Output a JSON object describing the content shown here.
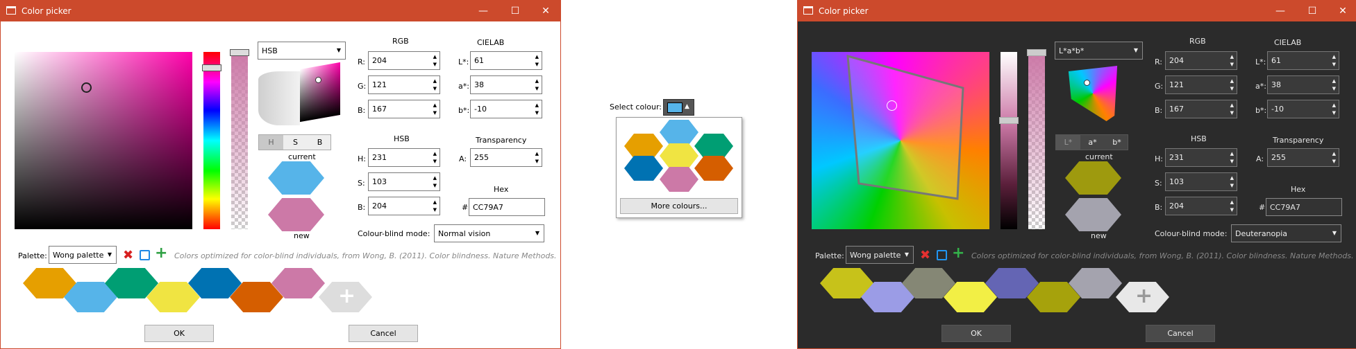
{
  "window_title": "Color picker",
  "title_buttons": {
    "minimize": "—",
    "maximize": "☐",
    "close": "✕"
  },
  "labels": {
    "rgb": "RGB",
    "cielab": "CIELAB",
    "hsb": "HSB",
    "transparency": "Transparency",
    "hex": "Hex",
    "r": "R:",
    "g": "G:",
    "b": "B:",
    "l": "L*:",
    "a_star": "a*:",
    "b_star": "b*:",
    "h": "H:",
    "s": "S:",
    "bri": "B:",
    "alpha": "A:",
    "hash": "#",
    "current": "current",
    "new": "new",
    "colour_blind_mode": "Colour-blind mode:",
    "palette": "Palette:"
  },
  "values": {
    "r": "204",
    "g": "121",
    "b": "167",
    "l": "61",
    "a_star": "38",
    "b_star": "-10",
    "h": "231",
    "s": "103",
    "bri": "204",
    "alpha": "255",
    "hex": "CC79A7"
  },
  "light": {
    "mode": "HSB",
    "tabs": [
      "H",
      "S",
      "B"
    ],
    "colour_blind": "Normal vision"
  },
  "dark": {
    "mode": "L*a*b*",
    "tabs": [
      "L*",
      "a*",
      "b*"
    ],
    "colour_blind": "Deuteranopia"
  },
  "palette": {
    "name": "Wong palette",
    "description": "Colors optimized for color-blind individuals, from Wong, B. (2011). Color blindness. Nature Methods.",
    "add_glyph": "+",
    "colors": [
      "#E69F00",
      "#56B4E9",
      "#009E73",
      "#F0E442",
      "#0072B2",
      "#D55E00",
      "#CC79A7"
    ],
    "dark_colors": [
      "#c7c21a",
      "#9b9ce6",
      "#858775",
      "#f2ef45",
      "#6465b4",
      "#a6a20c",
      "#a4a3ae"
    ]
  },
  "buttons": {
    "ok": "OK",
    "cancel": "Cancel"
  },
  "popup": {
    "label": "Select colour:",
    "more": "More colours...",
    "colors": [
      "#E69F00",
      "#56B4E9",
      "#F0E442",
      "#009E73",
      "#0072B2",
      "#CC79A7",
      "#D55E00"
    ]
  },
  "accent": "#cc4a2c"
}
